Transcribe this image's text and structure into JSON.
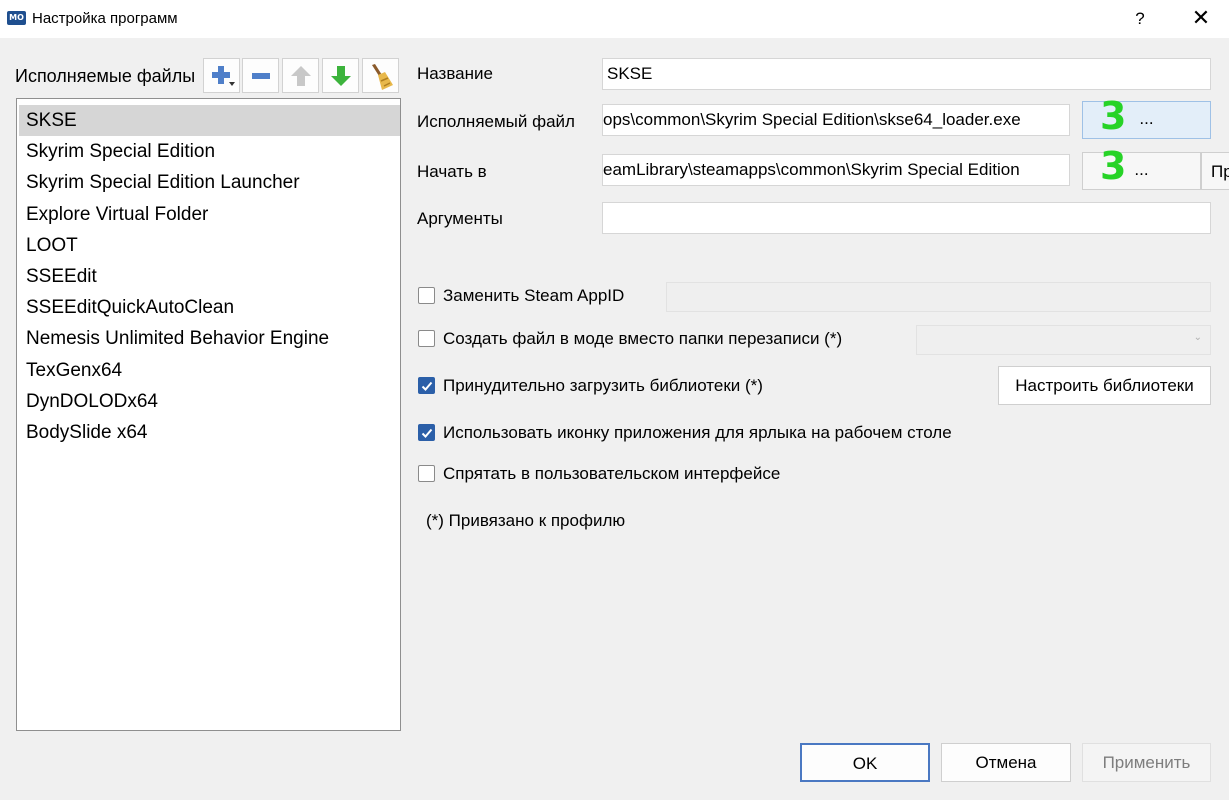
{
  "window": {
    "title": "Настройка программ",
    "icon_text": "MO",
    "help": "?",
    "close": "✕"
  },
  "toolbar": {
    "label": "Исполняемые файлы",
    "buttons": [
      "add-icon",
      "remove-icon",
      "move-up-icon",
      "move-down-icon",
      "clean-broom-icon"
    ]
  },
  "executables": [
    "SKSE",
    "Skyrim Special Edition",
    "Skyrim Special Edition Launcher",
    "Explore Virtual Folder",
    "LOOT",
    "SSEEdit",
    "SSEEditQuickAutoClean",
    "Nemesis Unlimited Behavior Engine",
    "TexGenx64",
    "DynDOLODx64",
    "BodySlide x64"
  ],
  "selected_index": 0,
  "form": {
    "title_label": "Название",
    "title_value": "SKSE",
    "binary_label": "Исполняемый файл",
    "binary_value": "ops\\common\\Skyrim Special Edition\\skse64_loader.exe",
    "start_in_label": "Начать в",
    "start_in_value": "eamLibrary\\steamapps\\common\\Skyrim Special Edition",
    "arguments_label": "Аргументы",
    "arguments_value": "",
    "browse_label": "...",
    "cut_button_text": "Пр"
  },
  "annotations": {
    "binary_mark": "3",
    "start_in_mark": "3",
    "color": "#27d327"
  },
  "options": {
    "steam_appid_label": "Заменить Steam AppID",
    "steam_appid_checked": false,
    "create_file_label": "Создать файл в моде вместо папки перезаписи (*)",
    "create_file_checked": false,
    "force_libs_label": "Принудительно загрузить библиотеки (*)",
    "force_libs_checked": true,
    "configure_libs_button": "Настроить библиотеки",
    "use_icon_label": "Использовать иконку приложения для ярлыка на рабочем столе",
    "use_icon_checked": true,
    "hide_label": "Спрятать в пользовательском интерфейсе",
    "hide_checked": false,
    "note": "(*) Привязано к профилю"
  },
  "buttons": {
    "ok": "OK",
    "cancel": "Отмена",
    "apply": "Применить"
  }
}
